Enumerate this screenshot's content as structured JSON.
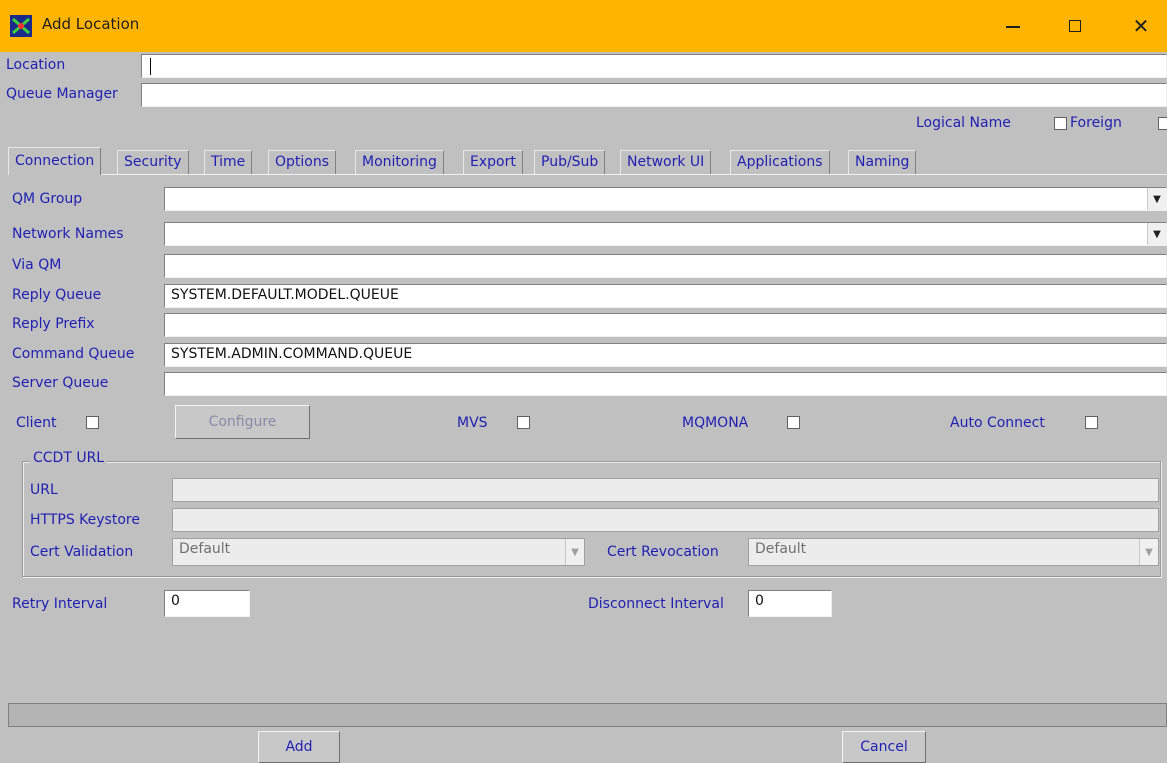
{
  "window": {
    "title": "Add Location",
    "minimize_label": "—",
    "close_label": "✕"
  },
  "top_fields": {
    "location_label": "Location",
    "location_value": "",
    "queue_manager_label": "Queue Manager",
    "queue_manager_value": "",
    "logical_name_label": "Logical Name",
    "foreign_label": "Foreign"
  },
  "tabs": [
    {
      "label": "Connection",
      "active": true
    },
    {
      "label": "Security"
    },
    {
      "label": "Time"
    },
    {
      "label": "Options"
    },
    {
      "label": "Monitoring"
    },
    {
      "label": "Export"
    },
    {
      "label": "Pub/Sub"
    },
    {
      "label": "Network UI"
    },
    {
      "label": "Applications"
    },
    {
      "label": "Naming"
    }
  ],
  "connection": {
    "qm_group_label": "QM Group",
    "qm_group_value": "",
    "network_names_label": "Network Names",
    "network_names_value": "",
    "via_qm_label": "Via QM",
    "via_qm_value": "",
    "reply_queue_label": "Reply Queue",
    "reply_queue_value": "SYSTEM.DEFAULT.MODEL.QUEUE",
    "reply_prefix_label": "Reply Prefix",
    "reply_prefix_value": "",
    "command_queue_label": "Command Queue",
    "command_queue_value": "SYSTEM.ADMIN.COMMAND.QUEUE",
    "server_queue_label": "Server Queue",
    "server_queue_value": "",
    "client_label": "Client",
    "configure_label": "Configure",
    "mvs_label": "MVS",
    "mqmona_label": "MQMONA",
    "auto_connect_label": "Auto Connect",
    "ccdt": {
      "group_title": "CCDT URL",
      "url_label": "URL",
      "url_value": "",
      "https_keystore_label": "HTTPS Keystore",
      "https_keystore_value": "",
      "cert_validation_label": "Cert Validation",
      "cert_validation_value": "Default",
      "cert_revocation_label": "Cert Revocation",
      "cert_revocation_value": "Default"
    },
    "retry_interval_label": "Retry Interval",
    "retry_interval_value": "0",
    "disconnect_interval_label": "Disconnect Interval",
    "disconnect_interval_value": "0"
  },
  "footer": {
    "add_label": "Add",
    "cancel_label": "Cancel"
  },
  "colors": {
    "titlebar": "#ffb400",
    "label_text": "#1f1fb4",
    "background": "#c0c0c0"
  }
}
